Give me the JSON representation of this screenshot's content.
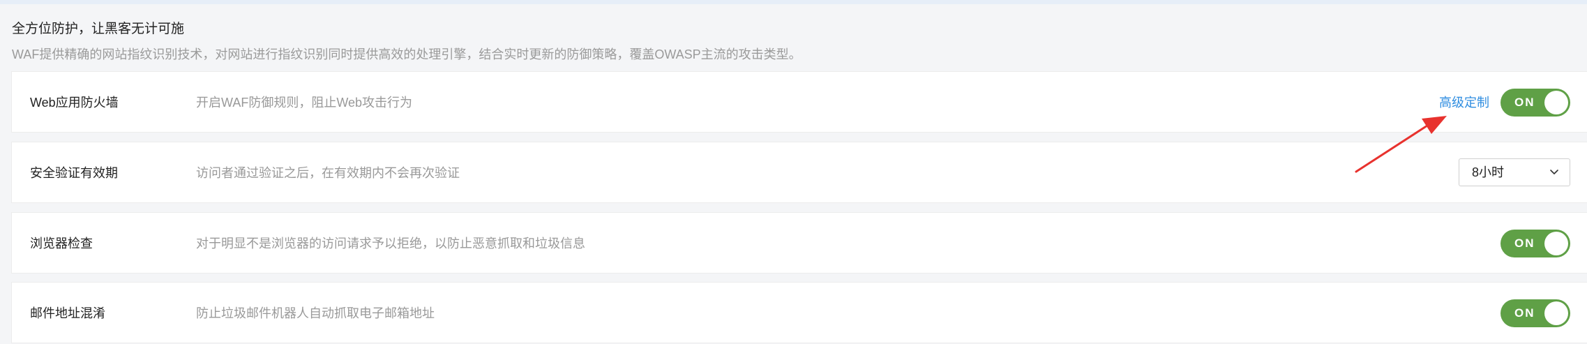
{
  "section": {
    "title": "全方位防护，让黑客无计可施",
    "description": "WAF提供精确的网站指纹识别技术，对网站进行指纹识别同时提供高效的处理引擎，结合实时更新的防御策略，覆盖OWASP主流的攻击类型。"
  },
  "settings": [
    {
      "title": "Web应用防火墙",
      "description": "开启WAF防御规则，阻止Web攻击行为",
      "link_label": "高级定制",
      "toggle_label": "ON"
    },
    {
      "title": "安全验证有效期",
      "description": "访问者通过验证之后，在有效期内不会再次验证",
      "select_value": "8小时"
    },
    {
      "title": "浏览器检查",
      "description": "对于明显不是浏览器的访问请求予以拒绝，以防止恶意抓取和垃圾信息",
      "toggle_label": "ON"
    },
    {
      "title": "邮件地址混淆",
      "description": "防止垃圾邮件机器人自动抓取电子邮箱地址",
      "toggle_label": "ON"
    }
  ],
  "colors": {
    "toggle_on": "#5fa046",
    "link": "#2f8de0",
    "annotation_arrow": "#e8322e"
  },
  "icons": {
    "select_caret": "chevron-down-icon",
    "annotation": "red-arrow-annotation"
  }
}
